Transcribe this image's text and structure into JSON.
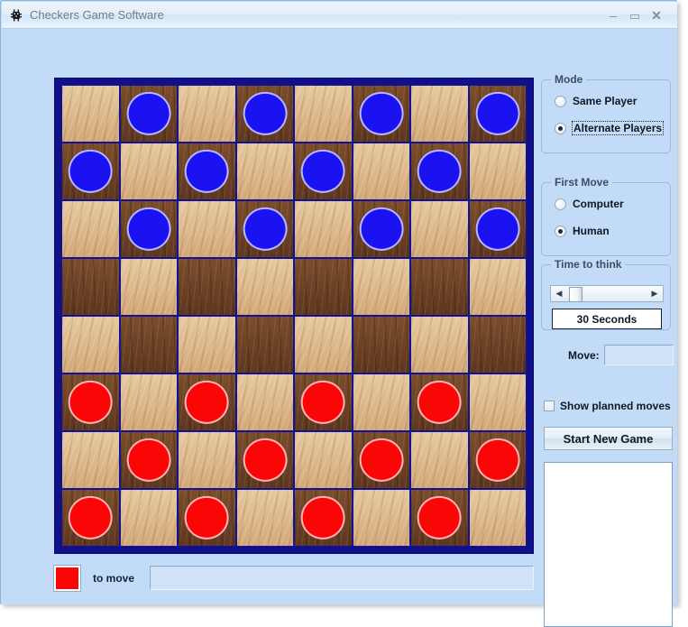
{
  "window": {
    "title": "Checkers Game Software",
    "icon": "bug-icon",
    "minimize_label": "–",
    "maximize_label": "▭",
    "close_label": "✕",
    "background_color": "#c2dcf7"
  },
  "board": {
    "border_color": "#10118a",
    "light_square_color": "#dcb98b",
    "dark_square_color": "#6e4426",
    "blue_piece_color": "#1a12f0",
    "red_piece_color": "#fb0606",
    "rows": 8,
    "columns": 8,
    "cells": [
      [
        "light",
        "dark-blue",
        "light",
        "dark-blue",
        "light",
        "dark-blue",
        "light",
        "dark-blue"
      ],
      [
        "dark-blue",
        "light",
        "dark-blue",
        "light",
        "dark-blue",
        "light",
        "dark-blue",
        "light"
      ],
      [
        "light",
        "dark-blue",
        "light",
        "dark-blue",
        "light",
        "dark-blue",
        "light",
        "dark-blue"
      ],
      [
        "dark",
        "light",
        "dark",
        "light",
        "dark",
        "light",
        "dark",
        "light"
      ],
      [
        "light",
        "dark",
        "light",
        "dark",
        "light",
        "dark",
        "light",
        "dark"
      ],
      [
        "dark-red",
        "light",
        "dark-red",
        "light",
        "dark-red",
        "light",
        "dark-red",
        "light"
      ],
      [
        "light",
        "dark-red",
        "light",
        "dark-red",
        "light",
        "dark-red",
        "light",
        "dark-red"
      ],
      [
        "dark-red",
        "light",
        "dark-red",
        "light",
        "dark-red",
        "light",
        "dark-red",
        "light"
      ]
    ]
  },
  "status": {
    "turn_color": "#fb0606",
    "turn_label": "to move",
    "status_field_value": ""
  },
  "mode_group": {
    "title": "Mode",
    "options": [
      {
        "label": "Same Player",
        "selected": false,
        "focused": false
      },
      {
        "label": "Alternate Players",
        "selected": true,
        "focused": true
      }
    ]
  },
  "first_move_group": {
    "title": "First Move",
    "options": [
      {
        "label": "Computer",
        "selected": false,
        "focused": false
      },
      {
        "label": "Human",
        "selected": true,
        "focused": false
      }
    ]
  },
  "time_group": {
    "title": "Time to think",
    "scroll_left_label": "◀",
    "scroll_right_label": "▶",
    "value": "30 Seconds"
  },
  "move": {
    "label": "Move:",
    "value": "",
    "placeholder": ""
  },
  "show_planned": {
    "label": "Show planned moves",
    "checked": false
  },
  "start_button": {
    "label": "Start New Game"
  },
  "log_list": {
    "items": []
  }
}
